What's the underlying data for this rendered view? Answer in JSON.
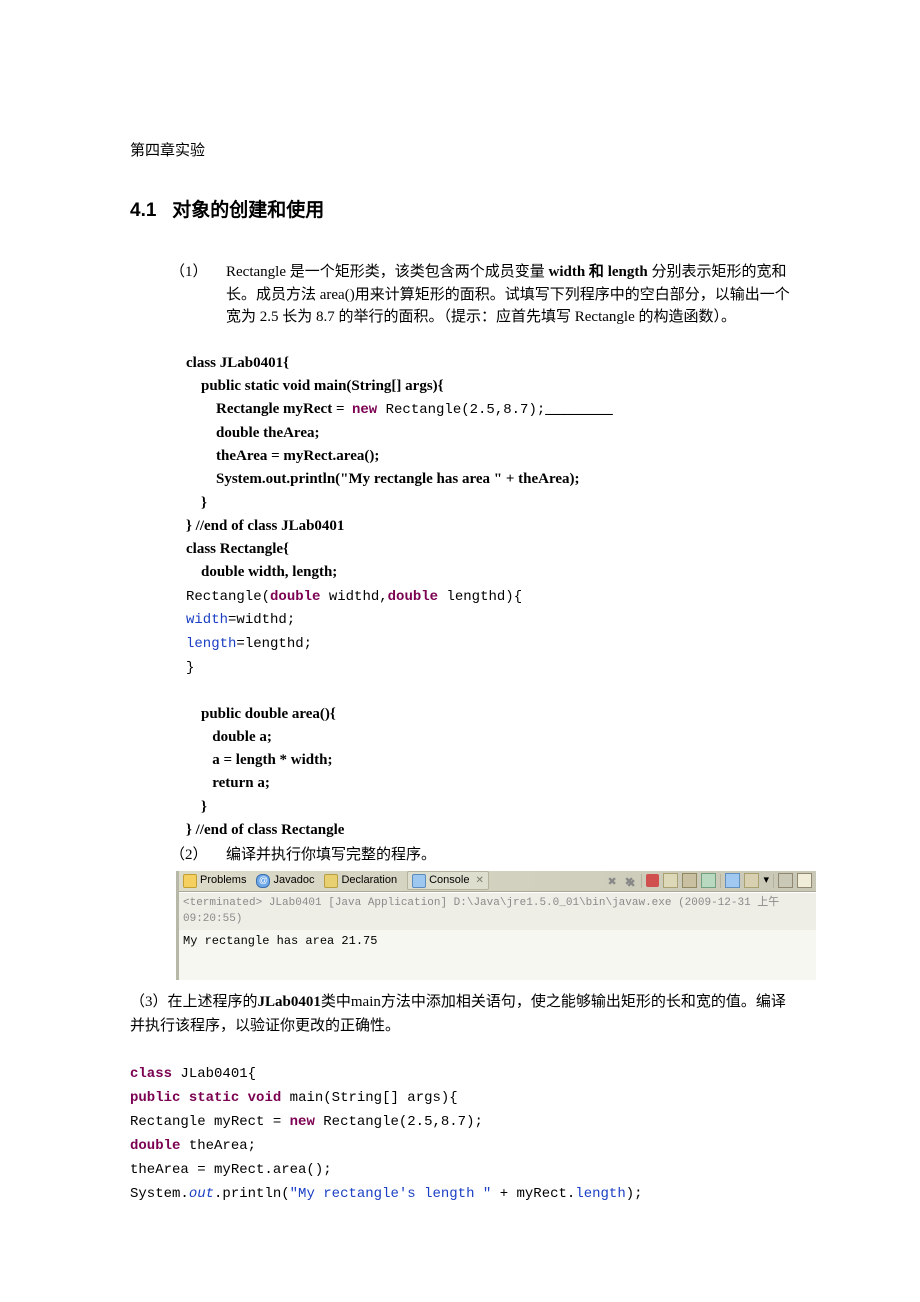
{
  "meta": {
    "chapter_sub": "第四章实验"
  },
  "section": {
    "number": "4.1",
    "title": "对象的创建和使用"
  },
  "q1": {
    "num": "（1）",
    "p1": "Rectangle 是一个矩形类，该类包含两个成员变量 ",
    "w": "width",
    "and": " 和 ",
    "l": "length",
    "p1b": " 分别表示矩形的宽和长。成员方法 area()用来计算矩形的面积。试填写下列程序中的空白部分，以输出一个宽为 2.5 长为 8.7 的举行的面积。（提示：应首先填写 Rectangle 的构造函数）。"
  },
  "code1": {
    "l1": "class JLab0401{",
    "l2": "    public static void main(String[] args){",
    "l3a": "        Rectangle myRect =  ",
    "l3new": "new",
    "l3b": " Rectangle(2.5,8.7);",
    "l3blank": "_________",
    "l4": "        double theArea;",
    "l5": "        theArea = myRect.area();",
    "l6": "        System.out.println(\"My rectangle has area \" + theArea);",
    "l7": "    }",
    "l8": "} //end of class JLab0401",
    "l9": "class Rectangle{",
    "l10": "    double width, length;",
    "m1": "Rectangle(",
    "m1kw": "double",
    "m1mid": " widthd,",
    "m1kw2": "double",
    "m1end": " lengthd){",
    "m2a": "width",
    "m2b": "=widthd;",
    "m3a": "length",
    "m3b": "=lengthd;",
    "m4": "}",
    "l11": "    public double area(){",
    "l12": "       double a;",
    "l13": "       a = length * width;",
    "l14": "       return a;",
    "l15": "    }",
    "l16": "} //end of class Rectangle"
  },
  "q2": {
    "num": "（2）",
    "text": "编译并执行你填写完整的程序。"
  },
  "console": {
    "tab_problems": "Problems",
    "tab_javadoc": "Javadoc",
    "tab_declaration": "Declaration",
    "tab_console": "Console",
    "close": "✕",
    "meta": "<terminated> JLab0401 [Java Application] D:\\Java\\jre1.5.0_01\\bin\\javaw.exe (2009-12-31 上午09:20:55)",
    "out": "My rectangle has area 21.75"
  },
  "q3": {
    "p1a": "（3）在上述程序的",
    "p1b": "JLab0401",
    "p1c": "类中main方法中添加相关语句，使之能够输出矩形的长和宽的值。编译并执行该程序，以验证你更改的正确性。"
  },
  "code2": {
    "l1a": "class",
    "l1b": " JLab0401{",
    "l2a": "public",
    "l2b": "static",
    "l2c": "void",
    "l2d": " main(String[] args){",
    "l3a": "Rectangle myRect = ",
    "l3b": "new",
    "l3c": " Rectangle(2.5,8.7);",
    "l4a": "double",
    "l4b": " theArea;",
    "l5": "theArea = myRect.area();",
    "l6a": "System.",
    "l6b": "out",
    "l6c": ".println(",
    "l6d": "\"My rectangle's length \"",
    "l6e": " + myRect.",
    "l6f": "length",
    "l6g": ");"
  },
  "icons": {
    "problems": "problems-icon",
    "javadoc": "javadoc-icon",
    "declaration": "declaration-icon",
    "console": "console-icon"
  }
}
